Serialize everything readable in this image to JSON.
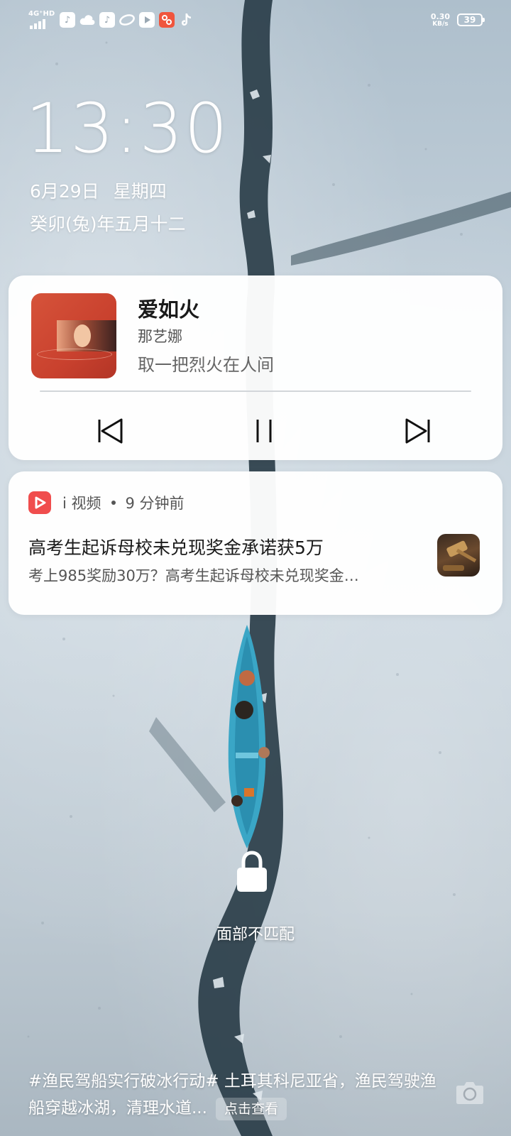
{
  "status_bar": {
    "network_type": "4G⁺HD",
    "app_icons": [
      "qq-music-icon",
      "weather-cloud-icon",
      "qq-music-icon",
      "link-icon",
      "video-play-icon",
      "app-red-icon",
      "tiktok-icon"
    ],
    "speed_value": "0.30",
    "speed_unit": "KB/s",
    "battery": "39"
  },
  "lockscreen": {
    "time": "13:30",
    "date": "6月29日",
    "weekday": "星期四",
    "lunar": "癸卯(兔)年五月十二",
    "face_status": "面部不匹配"
  },
  "music": {
    "title": "爱如火",
    "artist": "那艺娜",
    "lyric": "取一把烈火在人间",
    "progress_fraction": 0.0
  },
  "notification": {
    "app_name": "i 视频",
    "time_ago": "9 分钟前",
    "title": "高考生起诉母校未兑现奖金承诺获5万",
    "snippet": "考上985奖励30万？高考生起诉母校未兑现奖金…"
  },
  "wallpaper_caption": {
    "text": "#渔民驾船实行破冰行动# 土耳其科尼亚省，渔民驾驶渔船穿越冰湖，清理水道...",
    "more_label": "点击查看"
  },
  "colors": {
    "card_bg": "#ffffff",
    "news_icon": "#f04d4d",
    "cover": "#c9412e"
  }
}
